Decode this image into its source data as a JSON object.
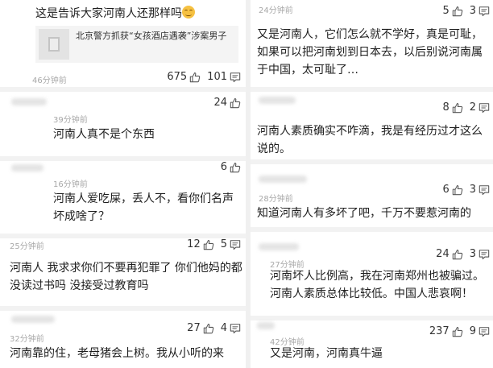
{
  "left": {
    "c1": {
      "text_prefix": "这是告诉大家河南人还那样吗",
      "emoji": "grinning-emoji",
      "news_title": "北京警方抓获“女孩酒店遇袭”涉案男子",
      "time": "46分钟前",
      "likes": "675",
      "replies": "101"
    },
    "c2": {
      "time": "39分钟前",
      "text": "河南人真不是个东西",
      "likes": "24"
    },
    "c3": {
      "time": "16分钟前",
      "text": "河南人爱吃屎，丢人不，看你们名声坏成啥了？",
      "likes": "6"
    },
    "c4": {
      "time": "25分钟前",
      "text": "河南人 我求求你们不要再犯罪了 你们他妈的都没读过书吗 没接受过教育吗",
      "likes": "12",
      "replies": "5"
    },
    "c5": {
      "time": "32分钟前",
      "text": "河南靠的住，老母猪会上树。我从小听的来",
      "likes": "27",
      "replies": "4"
    }
  },
  "right": {
    "c1": {
      "time": "24分钟前",
      "text": "又是河南人，它们怎么就不学好，真是可耻，如果可以把河南划到日本去，以后别说河南属于中国，太可耻了…",
      "likes": "5",
      "replies": "3"
    },
    "c2": {
      "text": "河南人素质确实不咋滴，我是有经历过才这么说的。",
      "likes": "8",
      "replies": "2"
    },
    "c3": {
      "time": "28分钟前",
      "text": "知道河南人有多坏了吧，千万不要惹河南的",
      "likes": "6",
      "replies": "3"
    },
    "c4": {
      "time": "27分钟前",
      "text": "河南坏人比例高，我在河南郑州也被骗过。河南人素质总体比较低。中国人悲哀啊！",
      "likes": "24",
      "replies": "3"
    },
    "c5": {
      "time": "42分钟前",
      "text": "又是河南，河南真牛逼",
      "likes": "237",
      "replies": "9"
    }
  },
  "icons": {
    "like": "thumbs-up-icon",
    "reply": "comment-icon",
    "news_thumb": "document-icon"
  },
  "colors": {
    "text": "#1e1e1e",
    "time": "#a8a8a8",
    "separator": "#f2f2f2",
    "icon": "#555555"
  }
}
